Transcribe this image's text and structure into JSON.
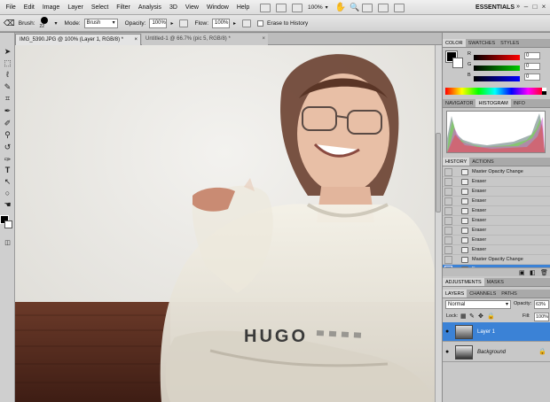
{
  "menubar": {
    "items": [
      "File",
      "Edit",
      "Image",
      "Layer",
      "Select",
      "Filter",
      "Analysis",
      "3D",
      "View",
      "Window",
      "Help"
    ],
    "zoom": "100%",
    "workspace": "ESSENTIALS",
    "window_buttons": [
      "–",
      "□",
      "×"
    ]
  },
  "options": {
    "brush_label": "Brush:",
    "brush_size": "22",
    "mode_label": "Mode:",
    "mode_value": "Brush",
    "opacity_label": "Opacity:",
    "opacity_value": "100%",
    "flow_label": "Flow:",
    "flow_value": "100%",
    "erase_history_label": "Erase to History"
  },
  "documents": {
    "tabs": [
      {
        "label": "IMG_5390.JPG @ 100% (Layer 1, RGB/8) *",
        "active": true
      },
      {
        "label": "Untitled-1 @ 66.7% (pic 5, RGB/8) *",
        "active": false
      }
    ]
  },
  "canvas": {
    "sweater_text": "HUGO"
  },
  "color_panel": {
    "tabs": [
      "COLOR",
      "SWATCHES",
      "STYLES"
    ],
    "channels": [
      {
        "label": "R",
        "value": "0"
      },
      {
        "label": "G",
        "value": "0"
      },
      {
        "label": "B",
        "value": "0"
      }
    ]
  },
  "navigator_panel": {
    "tabs": [
      "NAVIGATOR",
      "HISTOGRAM",
      "INFO"
    ]
  },
  "history_panel": {
    "tabs": [
      "HISTORY",
      "ACTIONS"
    ],
    "items": [
      "Master Opacity Change",
      "Eraser",
      "Eraser",
      "Eraser",
      "Eraser",
      "Eraser",
      "Eraser",
      "Eraser",
      "Eraser",
      "Master Opacity Change",
      "Eraser"
    ]
  },
  "adjustments_panel": {
    "tabs": [
      "ADJUSTMENTS",
      "MASKS"
    ]
  },
  "layers_panel": {
    "tabs": [
      "LAYERS",
      "CHANNELS",
      "PATHS"
    ],
    "blend_mode": "Normal",
    "opacity_label": "Opacity:",
    "opacity_value": "63%",
    "lock_label": "Lock:",
    "fill_label": "Fill:",
    "fill_value": "100%",
    "layers": [
      {
        "name": "Layer 1",
        "selected": true
      },
      {
        "name": "Background",
        "selected": false
      }
    ]
  },
  "colors": {
    "accent": "#3b82d6",
    "panel": "#c8c8c8"
  }
}
